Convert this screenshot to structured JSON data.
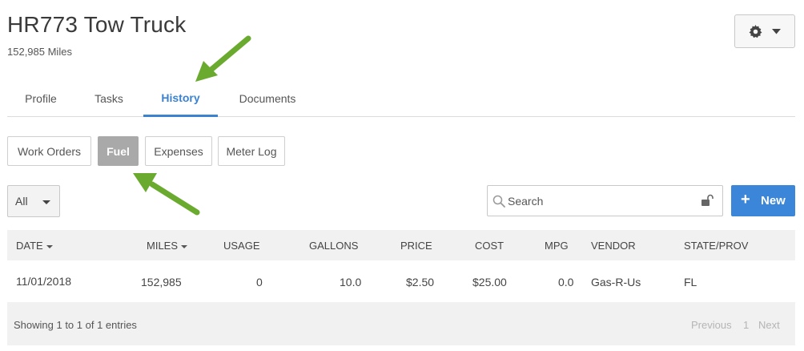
{
  "header": {
    "title": "HR773 Tow Truck",
    "subtitle": "152,985 Miles"
  },
  "tabs": [
    {
      "label": "Profile",
      "active": false
    },
    {
      "label": "Tasks",
      "active": false
    },
    {
      "label": "History",
      "active": true
    },
    {
      "label": "Documents",
      "active": false
    }
  ],
  "subtabs": [
    {
      "label": "Work Orders",
      "active": false
    },
    {
      "label": "Fuel",
      "active": true
    },
    {
      "label": "Expenses",
      "active": false
    },
    {
      "label": "Meter Log",
      "active": false
    }
  ],
  "toolbar": {
    "filter_value": "All",
    "search_placeholder": "Search",
    "new_label": "New"
  },
  "table": {
    "columns": [
      "DATE",
      "MILES",
      "USAGE",
      "GALLONS",
      "PRICE",
      "COST",
      "MPG",
      "VENDOR",
      "STATE/PROV"
    ],
    "rows": [
      [
        "11/01/2018",
        "152,985",
        "0",
        "10.0",
        "$2.50",
        "$25.00",
        "0.0",
        "Gas-R-Us",
        "FL"
      ]
    ],
    "footer_info": "Showing 1 to 1 of 1 entries",
    "pager": {
      "previous": "Previous",
      "page": "1",
      "next": "Next"
    }
  },
  "colors": {
    "accent": "#3b82d0",
    "active_subtab": "#a9a9a9",
    "arrow": "#6aaa2f"
  },
  "icons": [
    "gear-icon",
    "chevron-down-icon",
    "search-icon",
    "lock-icon",
    "plus-icon",
    "arrow-annotation"
  ]
}
